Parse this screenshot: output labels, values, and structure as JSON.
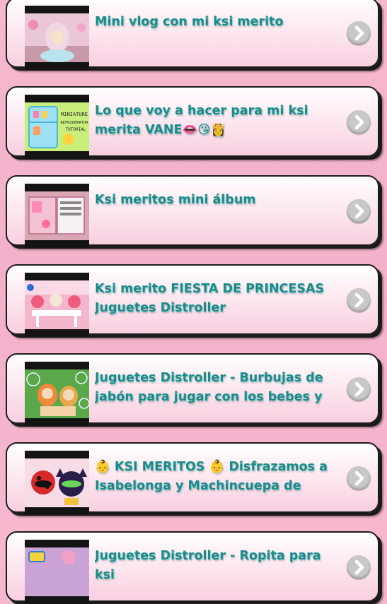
{
  "videos": [
    {
      "title": "Mini vlog con mi ksi merito",
      "thumb": "vlog"
    },
    {
      "title": "Lo que voy a hacer para mi ksi merita VANE👄😘👸",
      "thumb": "refrigerator",
      "thumb_caption": [
        "MINIATURE",
        "REFRIGERATOR",
        "TUTORIAL"
      ]
    },
    {
      "title": "Ksi meritos mini álbum",
      "thumb": "album"
    },
    {
      "title": "Ksi merito FIESTA DE PRINCESAS Juguetes Distroller",
      "thumb": "princesas"
    },
    {
      "title": "Juguetes Distroller - Burbujas de jabón para jugar con los bebes y ksi meritos,",
      "thumb": "burbujas"
    },
    {
      "title": "👶 KSI MERITOS 👶 Disfrazamos a Isabelonga y Machincuepa de Ladybug y",
      "thumb": "ladybug"
    },
    {
      "title": "Juguetes Distroller - Ropita para ksi",
      "thumb": "ropita"
    }
  ],
  "icons": {
    "open": "chevron-right-icon"
  },
  "colors": {
    "title": "#1a8b8a",
    "background": "#f4b3cc",
    "chevron_bg": "#c8c8c8"
  }
}
